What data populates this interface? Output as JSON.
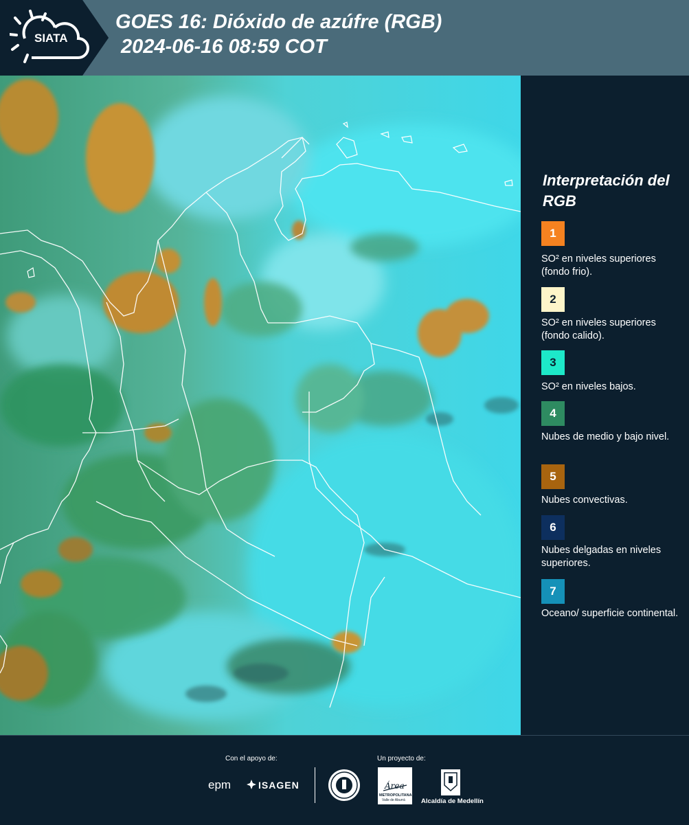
{
  "header": {
    "logo_text": "SIATA",
    "title_line1": "GOES 16: Dióxido de azúfre (RGB)",
    "title_line2": " 2024-06-16 08:59 COT"
  },
  "legend": {
    "title": "Interpretación del RGB",
    "items": [
      {
        "number": "1",
        "color": "#f58220",
        "label": "SO² en niveles superiores (fondo frio)."
      },
      {
        "number": "2",
        "color": "#fdf5c9",
        "label": "SO² en niveles superiores (fondo calido)."
      },
      {
        "number": "3",
        "color": "#1de9c9",
        "label": "SO² en niveles bajos."
      },
      {
        "number": "4",
        "color": "#2e8b61",
        "label": "Nubes de medio y bajo nivel."
      },
      {
        "number": "5",
        "color": "#a8640f",
        "label": "Nubes convectivas."
      },
      {
        "number": "6",
        "color": "#0d2f5e",
        "label": "Nubes delgadas en niveles superiores."
      },
      {
        "number": "7",
        "color": "#1591b8",
        "label": "Oceano/ superficie continental."
      }
    ]
  },
  "footer": {
    "support_label": "Con el apoyo de:",
    "project_label": "Un proyecto de:",
    "sponsor_1": "epm",
    "sponsor_2": "ISAGEN",
    "partner_2_line1": "METROPOLITANA",
    "partner_2_line2": "Valle de Aburrá",
    "partner_2_script": "Área",
    "partner_3": "Alcaldía de Medellín"
  }
}
